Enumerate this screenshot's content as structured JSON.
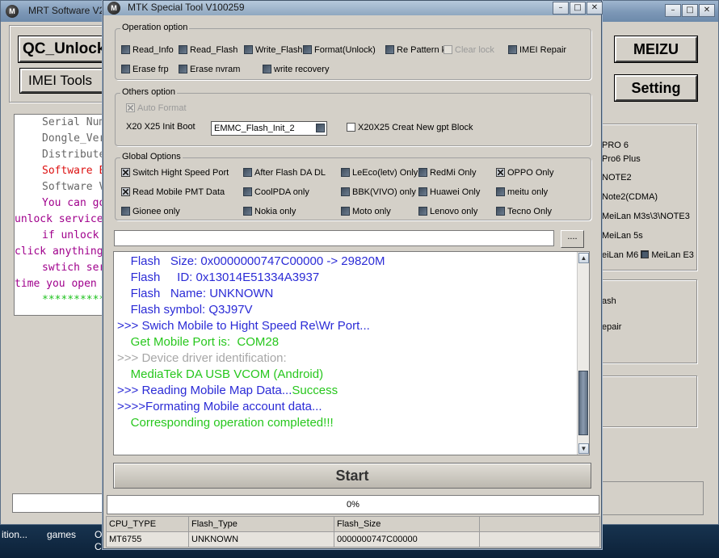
{
  "bg_window": {
    "title": "MRT Software V2",
    "buttons": {
      "qc_unlock": "QC_Unlock",
      "imei_tools": "IMEI Tools",
      "meizu": "MEIZU",
      "setting": "Setting"
    },
    "log_lines": [
      "Serial Num",
      "Dongle_Ver",
      "Distribute",
      "Software E",
      "Software V",
      "You can go",
      "unlock service",
      "if unlock",
      "click anything",
      "swtich ser",
      "time you open",
      "**********"
    ],
    "right_models": [
      "PRO 6",
      "Pro6 Plus",
      "NOTE2",
      "Note2(CDMA)",
      "MeiLan M3s\\3\\NOTE3",
      "MeiLan 5s",
      "eiLan M6",
      "MeiLan E3"
    ],
    "right_actions": [
      "ash",
      "epair"
    ]
  },
  "taskbar": {
    "items": [
      "ition...",
      "games",
      "O",
      "C"
    ]
  },
  "window": {
    "title": "MTK Special Tool V100259",
    "operation": {
      "legend": "Operation option",
      "options": [
        {
          "label": "Read_Info",
          "state": "unchecked"
        },
        {
          "label": "Read_Flash",
          "state": "unchecked"
        },
        {
          "label": "Write_Flash",
          "state": "unchecked"
        },
        {
          "label": "Format(Unlock)",
          "state": "unchecked"
        },
        {
          "label": "Re Pattern k",
          "state": "unchecked"
        },
        {
          "label": "Clear lock",
          "state": "disabled"
        },
        {
          "label": "IMEI Repair",
          "state": "unchecked"
        },
        {
          "label": "Erase frp",
          "state": "unchecked"
        },
        {
          "label": "Erase nvram",
          "state": "unchecked"
        },
        {
          "label": "write recovery",
          "state": "unchecked"
        }
      ]
    },
    "others": {
      "legend": "Others option",
      "auto_format": "Auto Format",
      "init_boot_label": "X20 X25 Init Boot",
      "init_boot_value": "EMMC_Flash_Init_2",
      "gpt_label": "X20X25 Creat New gpt Block"
    },
    "global": {
      "legend": "Global Options",
      "options": [
        {
          "label": "Switch Hight Speed Port",
          "state": "checked"
        },
        {
          "label": "After Flash DA DL",
          "state": "unchecked"
        },
        {
          "label": "LeEco(letv) Only",
          "state": "unchecked"
        },
        {
          "label": "RedMi Only",
          "state": "unchecked"
        },
        {
          "label": "OPPO Only",
          "state": "checked"
        },
        {
          "label": "Read Mobile PMT Data",
          "state": "checked"
        },
        {
          "label": "CoolPDA only",
          "state": "unchecked"
        },
        {
          "label": "BBK(VIVO) only",
          "state": "unchecked"
        },
        {
          "label": "Huawei Only",
          "state": "unchecked"
        },
        {
          "label": "meitu only",
          "state": "unchecked"
        },
        {
          "label": "Gionee only",
          "state": "unchecked"
        },
        {
          "label": "Nokia only",
          "state": "unchecked"
        },
        {
          "label": "Moto only",
          "state": "unchecked"
        },
        {
          "label": "Lenovo only",
          "state": "unchecked"
        },
        {
          "label": "Tecno Only",
          "state": "unchecked"
        }
      ]
    },
    "path_value": "",
    "browse_label": "....",
    "log": [
      {
        "text": "    Flash   Size: 0x0000000747C00000 -> 29820M",
        "color": "blue"
      },
      {
        "text": "    Flash     ID: 0x13014E51334A3937",
        "color": "blue"
      },
      {
        "text": "    Flash   Name: UNKNOWN",
        "color": "blue"
      },
      {
        "text": "    Flash symbol: Q3J97V",
        "color": "blue"
      },
      {
        "text": ">>> Swich Mobile to Hight Speed Re\\Wr Port...",
        "color": "blue"
      },
      {
        "text": "    Get Mobile Port is:  COM28",
        "color": "green"
      },
      {
        "text": ">>> Device driver identification:",
        "color": "gray"
      },
      {
        "text": "    MediaTek DA USB VCOM (Android)",
        "color": "green"
      },
      {
        "text": ">>> Reading Mobile Map Data...",
        "color": "blue",
        "suffix": "Success",
        "suffix_color": "green"
      },
      {
        "text": ">>>>Formating Mobile account data...",
        "color": "blue"
      },
      {
        "text": "    Corresponding operation completed!!!",
        "color": "green"
      }
    ],
    "start_label": "Start",
    "progress": {
      "value": 0,
      "label": "0%"
    },
    "table": {
      "headers": [
        "CPU_TYPE",
        "Flash_Type",
        "Flash_Size",
        ""
      ],
      "rows": [
        [
          "MT6755",
          "UNKNOWN",
          "0000000747C00000",
          ""
        ]
      ]
    }
  }
}
